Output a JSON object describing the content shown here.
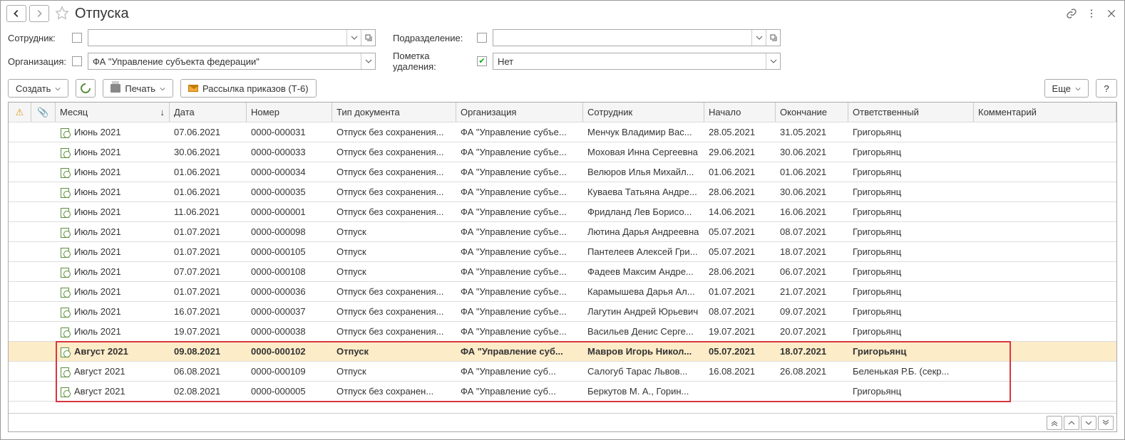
{
  "title": "Отпуска",
  "filters": {
    "employee_label": "Сотрудник:",
    "employee_value": "",
    "department_label": "Подразделение:",
    "department_value": "",
    "org_label": "Организация:",
    "org_value": "ФА \"Управление субъекта федерации\"",
    "delmark_label": "Пометка удаления:",
    "delmark_value": "Нет"
  },
  "toolbar": {
    "create": "Создать",
    "print": "Печать",
    "mailing": "Рассылка приказов (Т-6)",
    "more": "Еще",
    "help": "?"
  },
  "columns": {
    "month": "Месяц",
    "date": "Дата",
    "number": "Номер",
    "doctype": "Тип документа",
    "org": "Организация",
    "employee": "Сотрудник",
    "start": "Начало",
    "end": "Окончание",
    "responsible": "Ответственный",
    "comment": "Комментарий"
  },
  "rows": [
    {
      "month": "Июнь 2021",
      "date": "07.06.2021",
      "number": "0000-000031",
      "doctype": "Отпуск без сохранения...",
      "org": "ФА \"Управление субъе...",
      "employee": "Менчук Владимир Вас...",
      "start": "28.05.2021",
      "end": "31.05.2021",
      "responsible": "Григорьянц",
      "comment": ""
    },
    {
      "month": "Июнь 2021",
      "date": "30.06.2021",
      "number": "0000-000033",
      "doctype": "Отпуск без сохранения...",
      "org": "ФА \"Управление субъе...",
      "employee": "Моховая Инна Сергеевна",
      "start": "29.06.2021",
      "end": "30.06.2021",
      "responsible": "Григорьянц",
      "comment": ""
    },
    {
      "month": "Июнь 2021",
      "date": "01.06.2021",
      "number": "0000-000034",
      "doctype": "Отпуск без сохранения...",
      "org": "ФА \"Управление субъе...",
      "employee": "Велюров Илья Михайл...",
      "start": "01.06.2021",
      "end": "01.06.2021",
      "responsible": "Григорьянц",
      "comment": ""
    },
    {
      "month": "Июнь 2021",
      "date": "01.06.2021",
      "number": "0000-000035",
      "doctype": "Отпуск без сохранения...",
      "org": "ФА \"Управление субъе...",
      "employee": "Куваева Татьяна Андре...",
      "start": "28.06.2021",
      "end": "30.06.2021",
      "responsible": "Григорьянц",
      "comment": ""
    },
    {
      "month": "Июнь 2021",
      "date": "11.06.2021",
      "number": "0000-000001",
      "doctype": "Отпуск без сохранения...",
      "org": "ФА \"Управление субъе...",
      "employee": "Фридланд Лев Борисо...",
      "start": "14.06.2021",
      "end": "16.06.2021",
      "responsible": "Григорьянц",
      "comment": ""
    },
    {
      "month": "Июль 2021",
      "date": "01.07.2021",
      "number": "0000-000098",
      "doctype": "Отпуск",
      "org": "ФА \"Управление субъе...",
      "employee": "Лютина Дарья Андреевна",
      "start": "05.07.2021",
      "end": "08.07.2021",
      "responsible": "Григорьянц",
      "comment": ""
    },
    {
      "month": "Июль 2021",
      "date": "01.07.2021",
      "number": "0000-000105",
      "doctype": "Отпуск",
      "org": "ФА \"Управление субъе...",
      "employee": "Пантелеев Алексей Гри...",
      "start": "05.07.2021",
      "end": "18.07.2021",
      "responsible": "Григорьянц",
      "comment": ""
    },
    {
      "month": "Июль 2021",
      "date": "07.07.2021",
      "number": "0000-000108",
      "doctype": "Отпуск",
      "org": "ФА \"Управление субъе...",
      "employee": "Фадеев Максим Андре...",
      "start": "28.06.2021",
      "end": "06.07.2021",
      "responsible": "Григорьянц",
      "comment": ""
    },
    {
      "month": "Июль 2021",
      "date": "01.07.2021",
      "number": "0000-000036",
      "doctype": "Отпуск без сохранения...",
      "org": "ФА \"Управление субъе...",
      "employee": "Карамышева Дарья Ал...",
      "start": "01.07.2021",
      "end": "21.07.2021",
      "responsible": "Григорьянц",
      "comment": ""
    },
    {
      "month": "Июль 2021",
      "date": "16.07.2021",
      "number": "0000-000037",
      "doctype": "Отпуск без сохранения...",
      "org": "ФА \"Управление субъе...",
      "employee": "Лагутин Андрей Юрьевич",
      "start": "08.07.2021",
      "end": "09.07.2021",
      "responsible": "Григорьянц",
      "comment": ""
    },
    {
      "month": "Июль 2021",
      "date": "19.07.2021",
      "number": "0000-000038",
      "doctype": "Отпуск без сохранения...",
      "org": "ФА \"Управление субъе...",
      "employee": "Васильев Денис Серге...",
      "start": "19.07.2021",
      "end": "20.07.2021",
      "responsible": "Григорьянц",
      "comment": ""
    },
    {
      "month": "Август 2021",
      "date": "09.08.2021",
      "number": "0000-000102",
      "doctype": "Отпуск",
      "org": "ФА \"Управление суб...",
      "employee": "Мавров Игорь Никол...",
      "start": "05.07.2021",
      "end": "18.07.2021",
      "responsible": "Григорьянц",
      "comment": "",
      "selected": true,
      "hl": true
    },
    {
      "month": "Август 2021",
      "date": "06.08.2021",
      "number": "0000-000109",
      "doctype": "Отпуск",
      "org": "ФА \"Управление суб...",
      "employee": "Салогуб Тарас Львов...",
      "start": "16.08.2021",
      "end": "26.08.2021",
      "responsible": "Беленькая Р.Б. (секр...",
      "comment": "",
      "hl": true
    },
    {
      "month": "Август 2021",
      "date": "02.08.2021",
      "number": "0000-000005",
      "doctype": "Отпуск без сохранен...",
      "org": "ФА \"Управление суб...",
      "employee": "Беркутов М. А., Горин...",
      "start": "",
      "end": "",
      "responsible": "Григорьянц",
      "comment": "",
      "hl": true
    }
  ]
}
